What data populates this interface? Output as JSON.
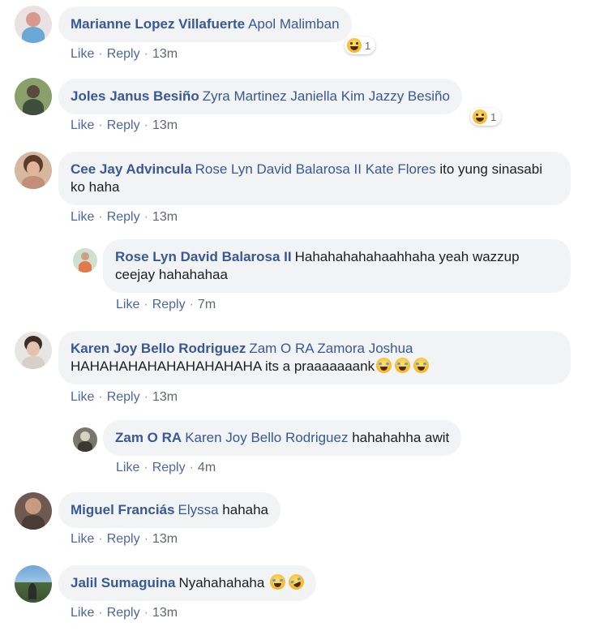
{
  "actions": {
    "like": "Like",
    "reply": "Reply",
    "sep": "·"
  },
  "comments": [
    {
      "author": "Marianne Lopez Villafuerte",
      "tags": "Apol Malimban",
      "text": "",
      "time": "13m",
      "reaction_count": "1"
    },
    {
      "author": "Joles Janus Besiño",
      "tags": "Zyra Martinez Janiella Kim Jazzy Besiño",
      "text": "",
      "time": "13m",
      "reaction_count": "1"
    },
    {
      "author": "Cee Jay Advincula",
      "tags": "Rose Lyn David Balarosa II Kate Flores",
      "text": " ito yung sinasabi ko haha",
      "time": "13m"
    },
    {
      "author": "Rose Lyn David Balarosa II",
      "tags": "",
      "text": "Hahahahahahaahhaha yeah wazzup ceejay hahahahaa",
      "time": "7m"
    },
    {
      "author": "Karen Joy Bello Rodriguez",
      "tags": "Zam O RA Zamora Joshua",
      "text": " HAHAHAHAHAHAHAHAHAHA its a praaaaaaank",
      "time": "13m",
      "emoji_count": 3
    },
    {
      "author": "Zam O RA",
      "tags": "Karen Joy Bello Rodriguez",
      "text": " hahahahha awit",
      "time": "4m"
    },
    {
      "author": "Miguel Franciás",
      "tags": "Elyssa",
      "text": " hahaha",
      "time": "13m"
    },
    {
      "author": "Jalil Sumaguina",
      "tags": "",
      "text": "Nyahahahaha ",
      "time": "13m",
      "emoji_count": 2
    }
  ],
  "colors": {
    "link": "#385898",
    "bubble": "#f2f3f5",
    "meta": "#606770"
  },
  "icons": {
    "reaction": "laughing-emoji-icon"
  }
}
